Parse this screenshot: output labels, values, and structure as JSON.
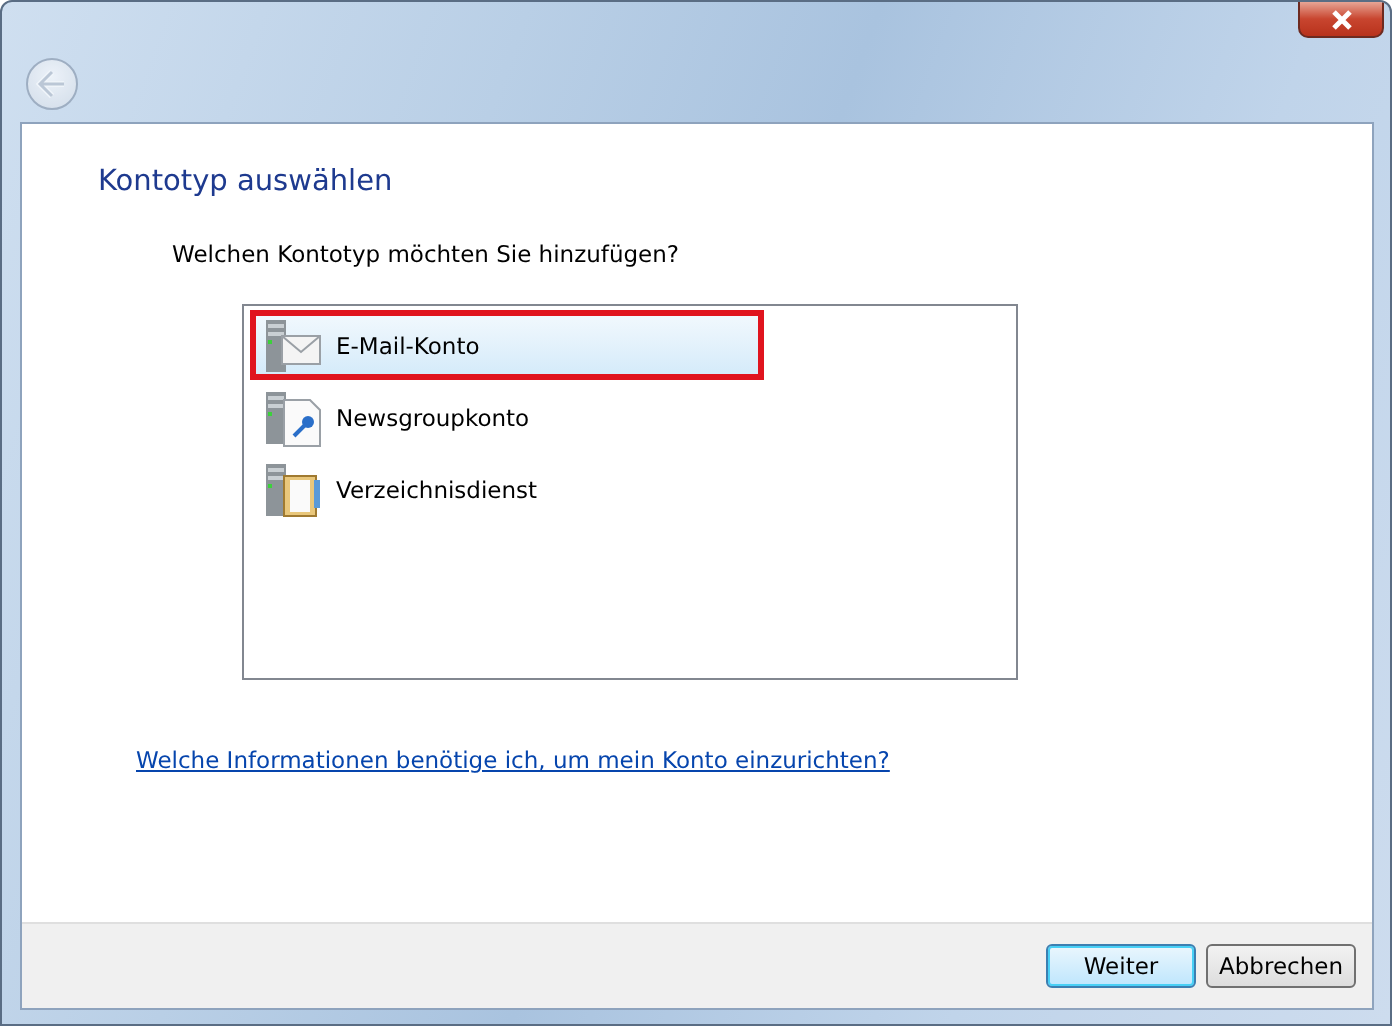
{
  "window": {
    "back_disabled": true
  },
  "heading": "Kontotyp auswählen",
  "question": "Welchen Kontotyp möchten Sie hinzufügen?",
  "account_types": [
    {
      "label": "E-Mail-Konto",
      "kind": "mail",
      "selected": true
    },
    {
      "label": "Newsgroupkonto",
      "kind": "news",
      "selected": false
    },
    {
      "label": "Verzeichnisdienst",
      "kind": "directory",
      "selected": false
    }
  ],
  "help_link": "Welche Informationen benötige ich, um mein Konto einzurichten?",
  "buttons": [
    {
      "label": "Weiter",
      "default": true
    },
    {
      "label": "Abbrechen",
      "default": false
    }
  ]
}
